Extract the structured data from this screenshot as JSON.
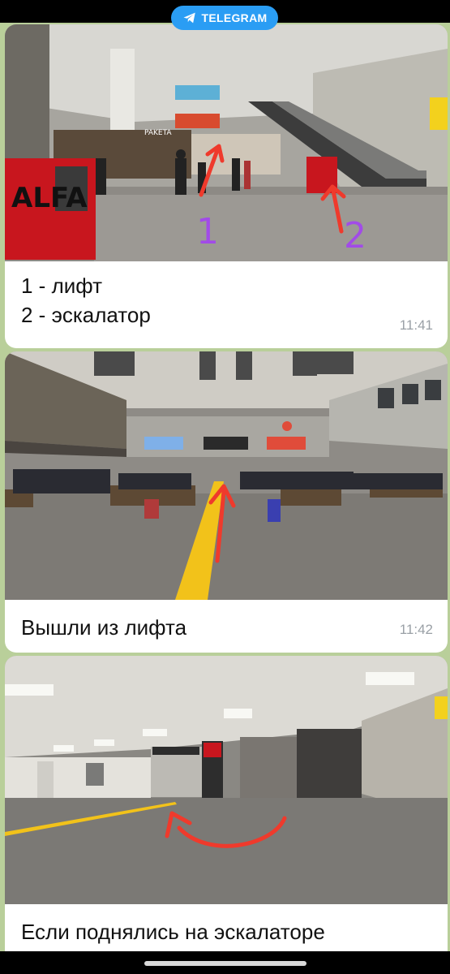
{
  "header": {
    "badge_label": "TELEGRAM",
    "badge_icon": "paper-plane-icon",
    "accent": "#2a9df4"
  },
  "messages": [
    {
      "photo_label": "escalator-and-lift-hall",
      "photo_signs": {
        "brand_sign": "ALFA",
        "marker_1": "1",
        "marker_2": "2",
        "shop_sign": "PAKETA"
      },
      "caption_lines": [
        "1 - лифт",
        "2 - эскалатор"
      ],
      "time": "11:41"
    },
    {
      "photo_label": "waiting-hall",
      "caption_lines": [
        "Вышли из лифта"
      ],
      "time": "11:42"
    },
    {
      "photo_label": "corridor-turn-left",
      "caption_lines": [
        "Если поднялись на эскалаторе"
      ]
    }
  ]
}
